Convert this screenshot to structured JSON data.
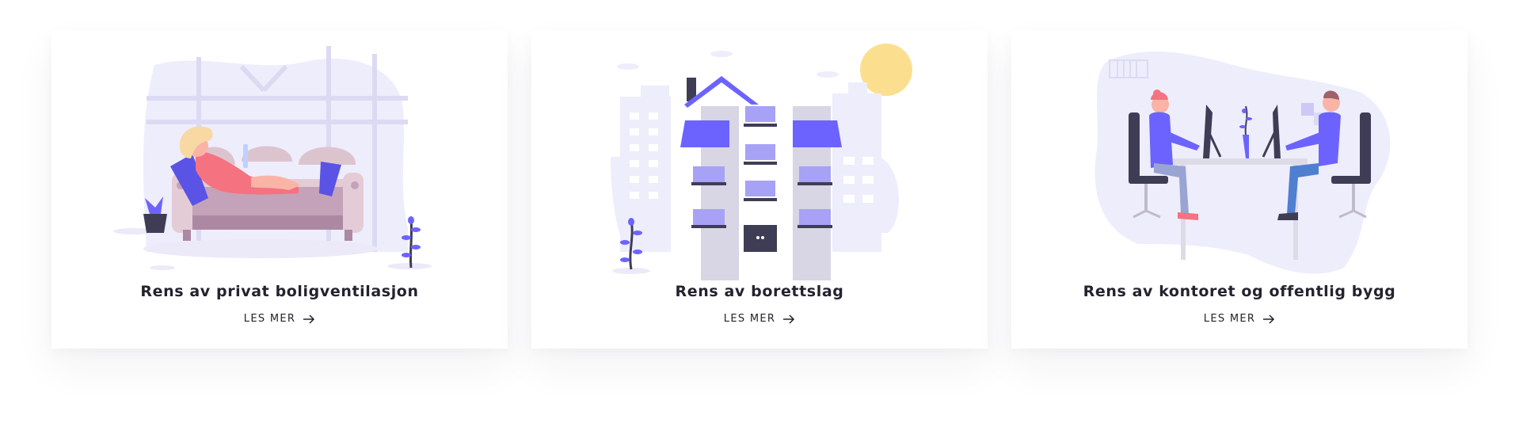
{
  "colors": {
    "accent": "#6c63ff",
    "text": "#23232f",
    "blob": "#eeedfb"
  },
  "cards": [
    {
      "title": "Rens av privat boligventilasjon",
      "link_label": "LES MER",
      "link_icon": "arrow-right-icon",
      "illustration": "woman-on-sofa-illustration"
    },
    {
      "title": "Rens av borettslag",
      "link_label": "LES MER",
      "link_icon": "arrow-right-icon",
      "illustration": "apartment-building-illustration"
    },
    {
      "title": "Rens av kontoret og offentlig bygg",
      "link_label": "LES MER",
      "link_icon": "arrow-right-icon",
      "illustration": "office-desk-illustration"
    }
  ]
}
